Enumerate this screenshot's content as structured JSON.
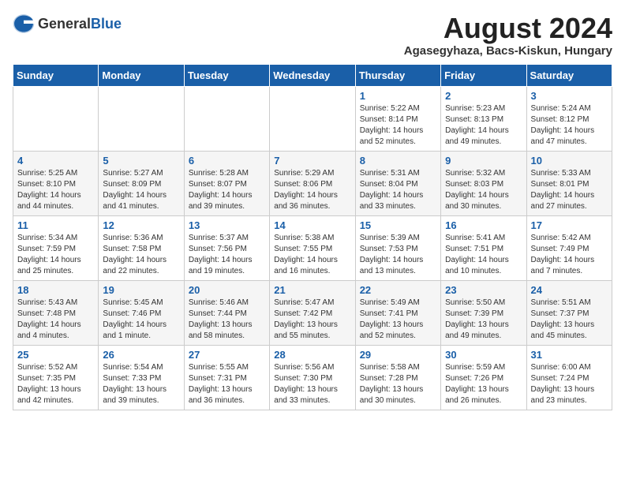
{
  "logo": {
    "general": "General",
    "blue": "Blue"
  },
  "header": {
    "month": "August 2024",
    "location": "Agasegyhaza, Bacs-Kiskun, Hungary"
  },
  "weekdays": [
    "Sunday",
    "Monday",
    "Tuesday",
    "Wednesday",
    "Thursday",
    "Friday",
    "Saturday"
  ],
  "weeks": [
    [
      {
        "day": "",
        "info": ""
      },
      {
        "day": "",
        "info": ""
      },
      {
        "day": "",
        "info": ""
      },
      {
        "day": "",
        "info": ""
      },
      {
        "day": "1",
        "info": "Sunrise: 5:22 AM\nSunset: 8:14 PM\nDaylight: 14 hours\nand 52 minutes."
      },
      {
        "day": "2",
        "info": "Sunrise: 5:23 AM\nSunset: 8:13 PM\nDaylight: 14 hours\nand 49 minutes."
      },
      {
        "day": "3",
        "info": "Sunrise: 5:24 AM\nSunset: 8:12 PM\nDaylight: 14 hours\nand 47 minutes."
      }
    ],
    [
      {
        "day": "4",
        "info": "Sunrise: 5:25 AM\nSunset: 8:10 PM\nDaylight: 14 hours\nand 44 minutes."
      },
      {
        "day": "5",
        "info": "Sunrise: 5:27 AM\nSunset: 8:09 PM\nDaylight: 14 hours\nand 41 minutes."
      },
      {
        "day": "6",
        "info": "Sunrise: 5:28 AM\nSunset: 8:07 PM\nDaylight: 14 hours\nand 39 minutes."
      },
      {
        "day": "7",
        "info": "Sunrise: 5:29 AM\nSunset: 8:06 PM\nDaylight: 14 hours\nand 36 minutes."
      },
      {
        "day": "8",
        "info": "Sunrise: 5:31 AM\nSunset: 8:04 PM\nDaylight: 14 hours\nand 33 minutes."
      },
      {
        "day": "9",
        "info": "Sunrise: 5:32 AM\nSunset: 8:03 PM\nDaylight: 14 hours\nand 30 minutes."
      },
      {
        "day": "10",
        "info": "Sunrise: 5:33 AM\nSunset: 8:01 PM\nDaylight: 14 hours\nand 27 minutes."
      }
    ],
    [
      {
        "day": "11",
        "info": "Sunrise: 5:34 AM\nSunset: 7:59 PM\nDaylight: 14 hours\nand 25 minutes."
      },
      {
        "day": "12",
        "info": "Sunrise: 5:36 AM\nSunset: 7:58 PM\nDaylight: 14 hours\nand 22 minutes."
      },
      {
        "day": "13",
        "info": "Sunrise: 5:37 AM\nSunset: 7:56 PM\nDaylight: 14 hours\nand 19 minutes."
      },
      {
        "day": "14",
        "info": "Sunrise: 5:38 AM\nSunset: 7:55 PM\nDaylight: 14 hours\nand 16 minutes."
      },
      {
        "day": "15",
        "info": "Sunrise: 5:39 AM\nSunset: 7:53 PM\nDaylight: 14 hours\nand 13 minutes."
      },
      {
        "day": "16",
        "info": "Sunrise: 5:41 AM\nSunset: 7:51 PM\nDaylight: 14 hours\nand 10 minutes."
      },
      {
        "day": "17",
        "info": "Sunrise: 5:42 AM\nSunset: 7:49 PM\nDaylight: 14 hours\nand 7 minutes."
      }
    ],
    [
      {
        "day": "18",
        "info": "Sunrise: 5:43 AM\nSunset: 7:48 PM\nDaylight: 14 hours\nand 4 minutes."
      },
      {
        "day": "19",
        "info": "Sunrise: 5:45 AM\nSunset: 7:46 PM\nDaylight: 14 hours\nand 1 minute."
      },
      {
        "day": "20",
        "info": "Sunrise: 5:46 AM\nSunset: 7:44 PM\nDaylight: 13 hours\nand 58 minutes."
      },
      {
        "day": "21",
        "info": "Sunrise: 5:47 AM\nSunset: 7:42 PM\nDaylight: 13 hours\nand 55 minutes."
      },
      {
        "day": "22",
        "info": "Sunrise: 5:49 AM\nSunset: 7:41 PM\nDaylight: 13 hours\nand 52 minutes."
      },
      {
        "day": "23",
        "info": "Sunrise: 5:50 AM\nSunset: 7:39 PM\nDaylight: 13 hours\nand 49 minutes."
      },
      {
        "day": "24",
        "info": "Sunrise: 5:51 AM\nSunset: 7:37 PM\nDaylight: 13 hours\nand 45 minutes."
      }
    ],
    [
      {
        "day": "25",
        "info": "Sunrise: 5:52 AM\nSunset: 7:35 PM\nDaylight: 13 hours\nand 42 minutes."
      },
      {
        "day": "26",
        "info": "Sunrise: 5:54 AM\nSunset: 7:33 PM\nDaylight: 13 hours\nand 39 minutes."
      },
      {
        "day": "27",
        "info": "Sunrise: 5:55 AM\nSunset: 7:31 PM\nDaylight: 13 hours\nand 36 minutes."
      },
      {
        "day": "28",
        "info": "Sunrise: 5:56 AM\nSunset: 7:30 PM\nDaylight: 13 hours\nand 33 minutes."
      },
      {
        "day": "29",
        "info": "Sunrise: 5:58 AM\nSunset: 7:28 PM\nDaylight: 13 hours\nand 30 minutes."
      },
      {
        "day": "30",
        "info": "Sunrise: 5:59 AM\nSunset: 7:26 PM\nDaylight: 13 hours\nand 26 minutes."
      },
      {
        "day": "31",
        "info": "Sunrise: 6:00 AM\nSunset: 7:24 PM\nDaylight: 13 hours\nand 23 minutes."
      }
    ]
  ]
}
